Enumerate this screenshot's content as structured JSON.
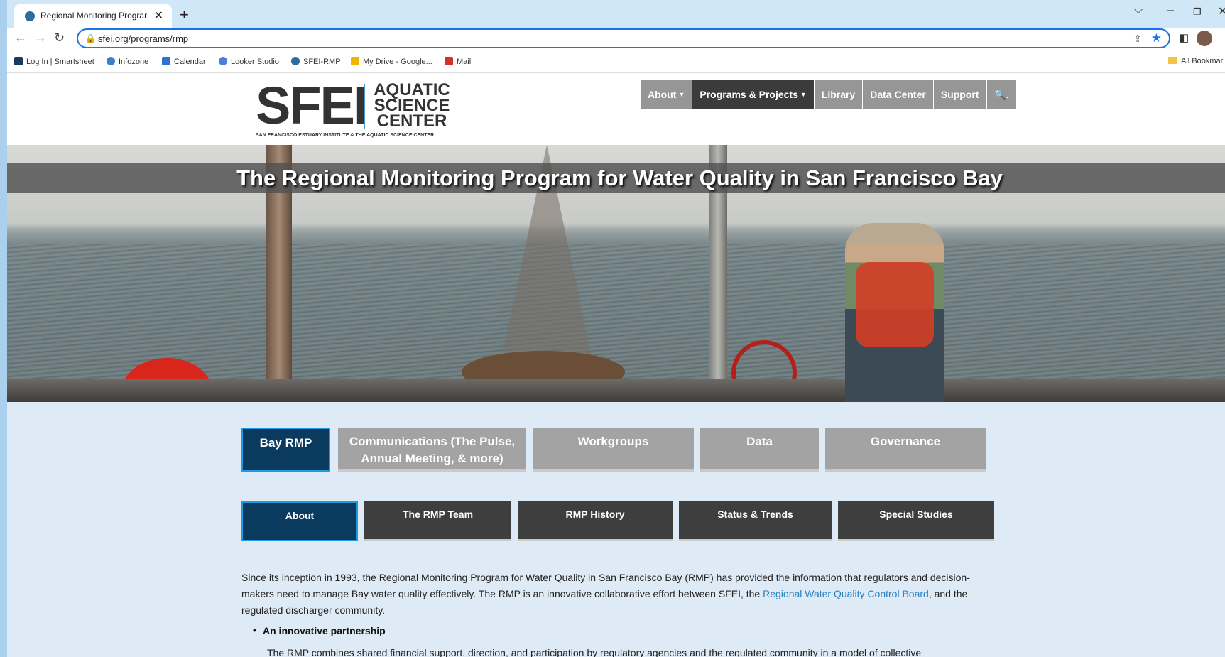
{
  "browser": {
    "tab_title": "Regional Monitoring Program fo",
    "url": "sfei.org/programs/rmp",
    "bookmarks": [
      {
        "label": "Log In | Smartsheet",
        "color": "#1c3a5f"
      },
      {
        "label": "Infozone",
        "color": "#3b82c4"
      },
      {
        "label": "Calendar",
        "color": "#2f6fd6"
      },
      {
        "label": "Looker Studio",
        "color": "#4f7be0"
      },
      {
        "label": "SFEI-RMP",
        "color": "#2e6b9e"
      },
      {
        "label": "My Drive - Google...",
        "color": "#f2b400"
      },
      {
        "label": "Mail",
        "color": "#d93025"
      }
    ],
    "all_bookmarks": "All Bookmar"
  },
  "site": {
    "logo_main": "SFEI",
    "logo_line1": "AQUATIC",
    "logo_line2": "SCIENCE",
    "logo_line3": "CENTER",
    "logo_sub": "SAN FRANCISCO ESTUARY INSTITUTE & THE AQUATIC SCIENCE CENTER",
    "nav": [
      "About",
      "Programs & Projects",
      "Library",
      "Data Center",
      "Support"
    ],
    "search_glyph": "🔍."
  },
  "hero": {
    "title": "The Regional Monitoring Program for Water Quality in San Francisco Bay"
  },
  "tabs_primary": [
    {
      "label": "Bay RMP"
    },
    {
      "label": "Communications (The Pulse, Annual Meeting, & more)"
    },
    {
      "label": "Workgroups"
    },
    {
      "label": "Data"
    },
    {
      "label": "Governance"
    }
  ],
  "tabs_secondary": [
    {
      "label": "About"
    },
    {
      "label": "The RMP Team"
    },
    {
      "label": "RMP History"
    },
    {
      "label": "Status & Trends"
    },
    {
      "label": "Special Studies"
    }
  ],
  "body": {
    "intro_a": "Since its inception in 1993, the Regional Monitoring Program for Water Quality in San Francisco Bay (RMP) has provided the information that regulators and decision-makers need to manage Bay water quality effectively. The RMP is an innovative collaborative effort between SFEI, the ",
    "intro_link": "Regional Water Quality Control Board",
    "intro_b": ", and the regulated discharger community.",
    "bullet_heading": "An innovative partnership",
    "bullet_text": "The RMP combines shared financial support, direction, and participation by regulatory agencies and the regulated community in a model of collective"
  }
}
